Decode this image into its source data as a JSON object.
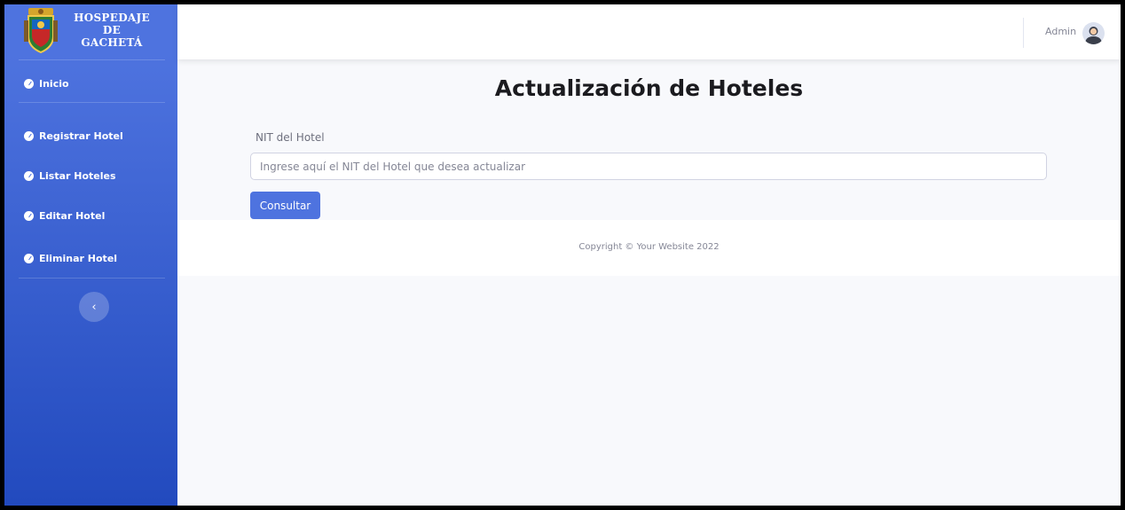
{
  "brand": {
    "line1": "HOSPEDAJE DE",
    "line2": "GACHETÁ"
  },
  "sidebar": {
    "items": [
      {
        "label": "Inicio"
      },
      {
        "label": "Registrar Hotel"
      },
      {
        "label": "Listar Hoteles"
      },
      {
        "label": "Editar Hotel"
      },
      {
        "label": "Eliminar Hotel"
      }
    ],
    "toggle_icon": "chevron-left-icon"
  },
  "topbar": {
    "user_name": "Admin"
  },
  "main": {
    "title": "Actualización de Hoteles",
    "field_label": "NIT del Hotel",
    "field_placeholder": "Ingrese aquí el NIT del Hotel que desea actualizar",
    "button_label": "Consultar"
  },
  "footer": {
    "copyright": "Copyright © Your Website 2022"
  },
  "colors": {
    "primary": "#4e73df",
    "primary_dark": "#224abe",
    "background": "#f8f9fc"
  }
}
